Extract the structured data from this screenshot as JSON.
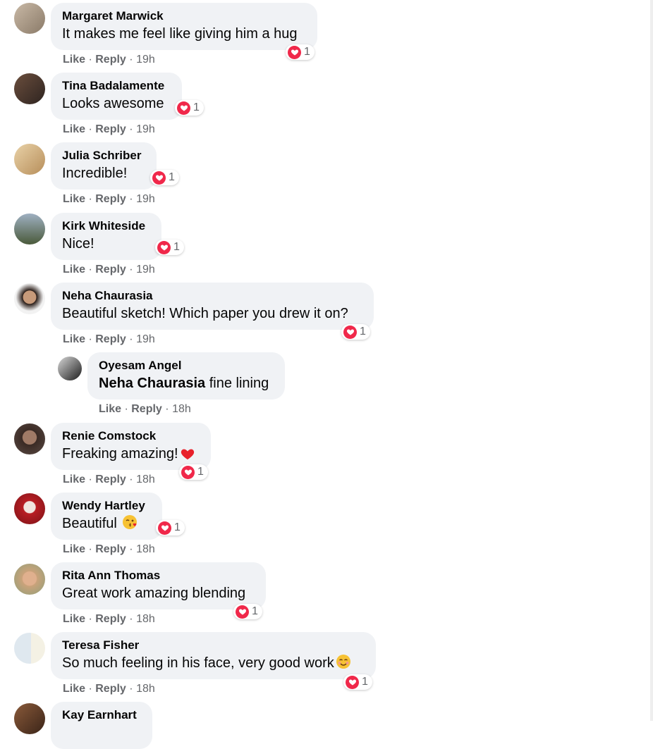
{
  "reaction_color": "#f0284a",
  "bubble_color": "#f0f2f5",
  "labels": {
    "like": "Like",
    "reply": "Reply",
    "sep": "·"
  },
  "comments": [
    {
      "name": "Margaret Marwick",
      "text": "It makes me feel like giving him a hug",
      "reaction_icon": "love-heart-icon",
      "reaction_count": "1",
      "time": "19h"
    },
    {
      "name": "Tina Badalamente",
      "text": "Looks awesome",
      "reaction_icon": "love-heart-icon",
      "reaction_count": "1",
      "time": "19h"
    },
    {
      "name": "Julia Schriber",
      "text": "Incredible!",
      "reaction_icon": "love-heart-icon",
      "reaction_count": "1",
      "time": "19h"
    },
    {
      "name": "Kirk Whiteside",
      "text": "Nice!",
      "reaction_icon": "love-heart-icon",
      "reaction_count": "1",
      "time": "19h"
    },
    {
      "name": "Neha Chaurasia",
      "text": "Beautiful sketch! Which paper you drew it on?",
      "reaction_icon": "love-heart-icon",
      "reaction_count": "1",
      "time": "19h"
    },
    {
      "name": "Oyesam Angel",
      "mention": "Neha Chaurasia",
      "text": " fine lining",
      "time": "18h"
    },
    {
      "name": "Renie Comstock",
      "text": "Freaking amazing!",
      "text_emoji": "red-heart-emoji",
      "reaction_icon": "love-heart-icon",
      "reaction_count": "1",
      "time": "18h"
    },
    {
      "name": "Wendy Hartley",
      "text": "Beautiful ",
      "text_emoji": "face-blowing-kiss-emoji",
      "reaction_icon": "love-heart-icon",
      "reaction_count": "1",
      "time": "18h"
    },
    {
      "name": "Rita Ann Thomas",
      "text": "Great work amazing blending",
      "reaction_icon": "love-heart-icon",
      "reaction_count": "1",
      "time": "18h"
    },
    {
      "name": "Teresa Fisher",
      "text": "So much feeling in his face, very good work",
      "text_emoji": "smiling-face-emoji",
      "reaction_icon": "love-heart-icon",
      "reaction_count": "1",
      "time": "18h"
    },
    {
      "name": "Kay Earnhart"
    }
  ]
}
